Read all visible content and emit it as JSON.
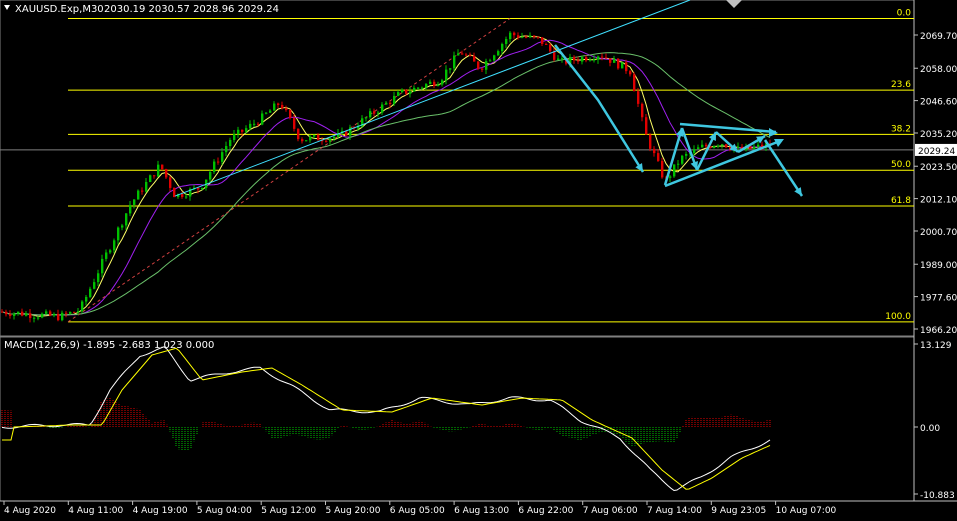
{
  "header": {
    "symbol": "XAUUSD.Exp,M30",
    "ohlc": "2030.19 2030.57 2028.96 2029.24"
  },
  "price_panel": {
    "axis_ticks": [
      "2069.70",
      "2058.00",
      "2046.60",
      "2035.20",
      "2023.50",
      "2012.10",
      "2000.70",
      "1989.00",
      "1977.60",
      "1966.20"
    ],
    "current_price": "2029.24",
    "fib_levels": [
      {
        "label": "0.0",
        "price": 2075.5
      },
      {
        "label": "23.6",
        "price": 2050.3
      },
      {
        "label": "38.2",
        "price": 2034.7
      },
      {
        "label": "50.0",
        "price": 2022.1
      },
      {
        "label": "61.8",
        "price": 2009.5
      },
      {
        "label": "100.0",
        "price": 1968.7
      }
    ]
  },
  "macd_panel": {
    "label": "MACD(12,26,9) -1.895 -2.683 1.023 0.000",
    "axis_ticks": [
      "13.129",
      "0.00",
      "-10.883"
    ]
  },
  "time_axis": {
    "labels": [
      "4 Aug 2020",
      "4 Aug 11:00",
      "4 Aug 19:00",
      "5 Aug 04:00",
      "5 Aug 12:00",
      "5 Aug 20:00",
      "6 Aug 05:00",
      "6 Aug 13:00",
      "6 Aug 22:00",
      "7 Aug 06:00",
      "7 Aug 14:00",
      "9 Aug 23:05",
      "10 Aug 07:00"
    ]
  },
  "colors": {
    "background": "#000000",
    "bull_candle": "#00c000",
    "bear_candle": "#e00000",
    "fib_line": "#ffff00",
    "trend_line": "#40e0ff",
    "arrow": "#3fc7e0",
    "ma_fast": "#ffff66",
    "ma_mid": "#a020f0",
    "ma_slow": "#6ac06a",
    "axis_text": "#ffffff",
    "grid_frame": "#c0c0c0"
  }
}
